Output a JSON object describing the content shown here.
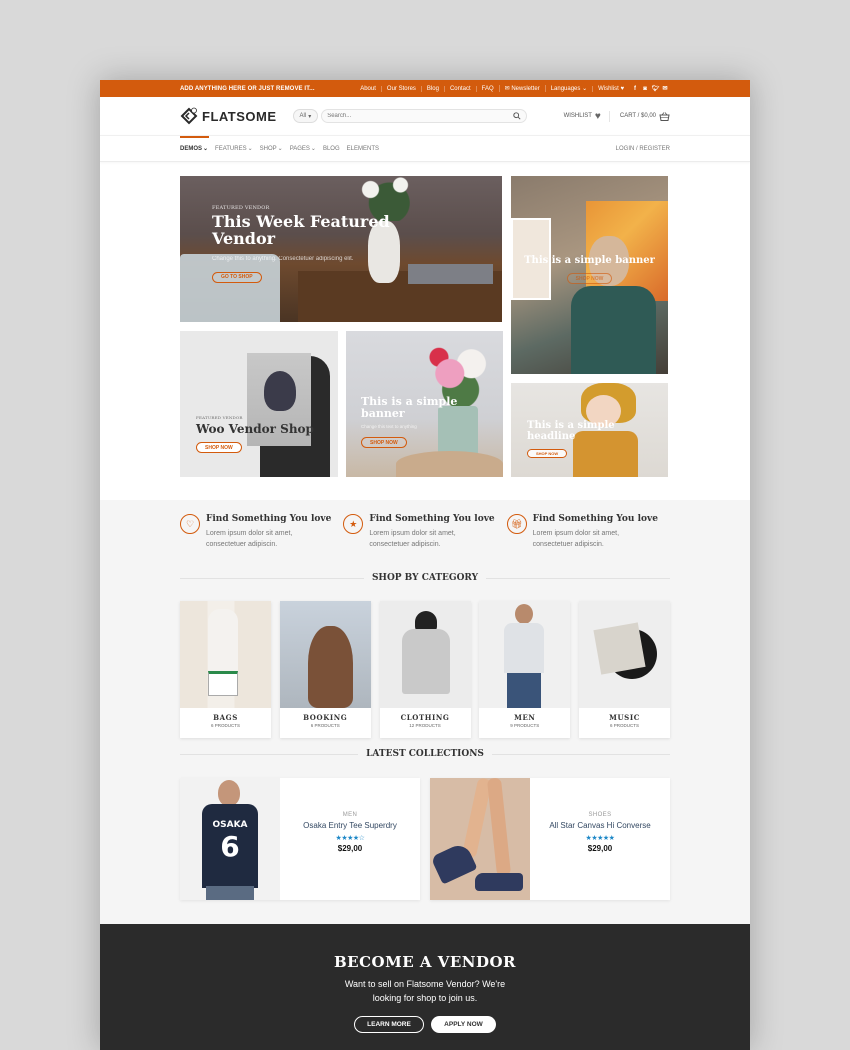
{
  "topbar": {
    "promo": "ADD ANYTHING HERE OR JUST REMOVE IT...",
    "links": [
      "About",
      "Our Stores",
      "Blog",
      "Contact",
      "FAQ",
      "Newsletter",
      "Languages",
      "Wishlist"
    ],
    "social": [
      "facebook-icon",
      "instagram-icon",
      "twitter-icon",
      "email-icon"
    ],
    "accent": "#d35b0d"
  },
  "header": {
    "logo": "FLATSOME",
    "category_select": "All",
    "search_placeholder": "Search...",
    "wishlist": "WISHLIST",
    "cart": "CART / $0,00"
  },
  "nav": {
    "items": [
      "DEMOS",
      "FEATURES",
      "SHOP",
      "PAGES",
      "BLOG",
      "ELEMENTS"
    ],
    "login": "LOGIN / REGISTER"
  },
  "banners": [
    {
      "kicker": "FEATURED VENDOR",
      "title": "This Week Featured Vendor",
      "sub": "Change this to anything. Consectetuer adipiscing elit.",
      "button": "GO TO SHOP"
    },
    {
      "title": "This is a simple banner",
      "button": "SHOP NOW"
    },
    {
      "kicker": "FEATURED VENDOR",
      "title": "Woo Vendor Shop",
      "button": "SHOP NOW"
    },
    {
      "title": "This is a simple banner",
      "sub": "Change this text to anything",
      "button": "SHOP NOW"
    },
    {
      "title": "This is a simple headline",
      "button": "SHOP NOW"
    }
  ],
  "features": [
    {
      "icon": "heart-icon",
      "title": "Find Something You love",
      "text": "Lorem ipsum dolor sit amet, consectetuer adipiscin."
    },
    {
      "icon": "star-icon",
      "title": "Find Something You love",
      "text": "Lorem ipsum dolor sit amet, consectetuer adipiscin."
    },
    {
      "icon": "gift-icon",
      "title": "Find Something You love",
      "text": "Lorem ipsum dolor sit amet, consectetuer adipiscin."
    }
  ],
  "shop_by_category": {
    "title": "SHOP BY CATEGORY",
    "categories": [
      {
        "name": "BAGS",
        "count": "6 PRODUCTS"
      },
      {
        "name": "BOOKING",
        "count": "6 PRODUCTS"
      },
      {
        "name": "CLOTHING",
        "count": "12 PRODUCTS"
      },
      {
        "name": "MEN",
        "count": "9 PRODUCTS"
      },
      {
        "name": "MUSIC",
        "count": "6 PRODUCTS"
      }
    ]
  },
  "latest": {
    "title": "LATEST COLLECTIONS",
    "products": [
      {
        "category": "MEN",
        "name": "Osaka Entry Tee Superdry",
        "rating": 4,
        "rating_max": 5,
        "price": "$29,00"
      },
      {
        "category": "SHOES",
        "name": "All Star Canvas Hi Converse",
        "rating": 5,
        "rating_max": 5,
        "price": "$29,00"
      }
    ]
  },
  "vendor": {
    "title": "BECOME A VENDOR",
    "text_line1": "Want to sell on Flatsome Vendor? We're",
    "text_line2": "looking for shop to join us.",
    "learn_more": "LEARN MORE",
    "apply_now": "APPLY NOW"
  }
}
